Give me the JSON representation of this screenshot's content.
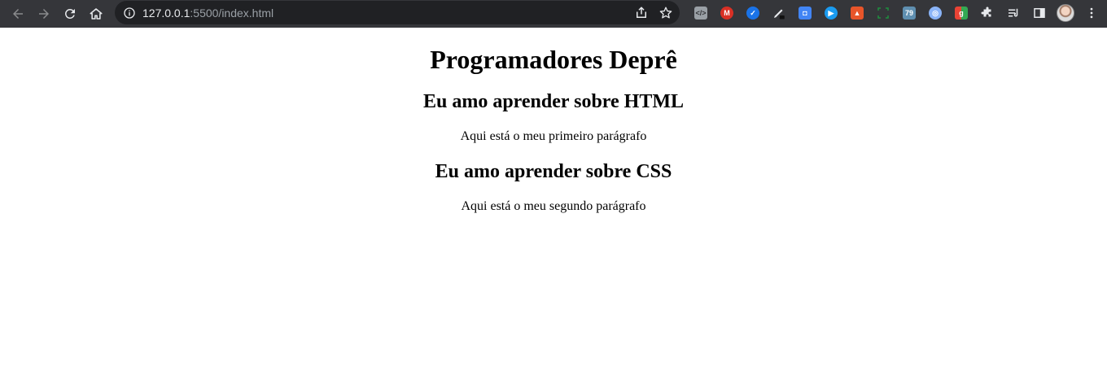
{
  "browser": {
    "url_host": "127.0.0.1",
    "url_rest": ":5500/index.html",
    "extension_badge": "79",
    "gmail_letter": "M"
  },
  "page": {
    "title": "Programadores Deprê",
    "heading_html": "Eu amo aprender sobre HTML",
    "paragraph_1": "Aqui está o meu primeiro parágrafo",
    "heading_css": "Eu amo aprender sobre CSS",
    "paragraph_2": "Aqui está o meu segundo parágrafo"
  },
  "icons": {
    "back": "arrow-left-icon",
    "forward": "arrow-right-icon",
    "reload": "reload-icon",
    "home": "home-icon",
    "site_info": "info-icon",
    "share": "share-icon",
    "bookmark": "star-icon",
    "extensions": "puzzle-icon",
    "reading_list": "reading-list-icon",
    "side_panel": "side-panel-icon",
    "menu": "kebab-menu-icon"
  },
  "colors": {
    "toolbar_bg": "#35363a",
    "omnibox_bg": "#202124",
    "page_bg": "#ffffff",
    "text": "#000000"
  }
}
